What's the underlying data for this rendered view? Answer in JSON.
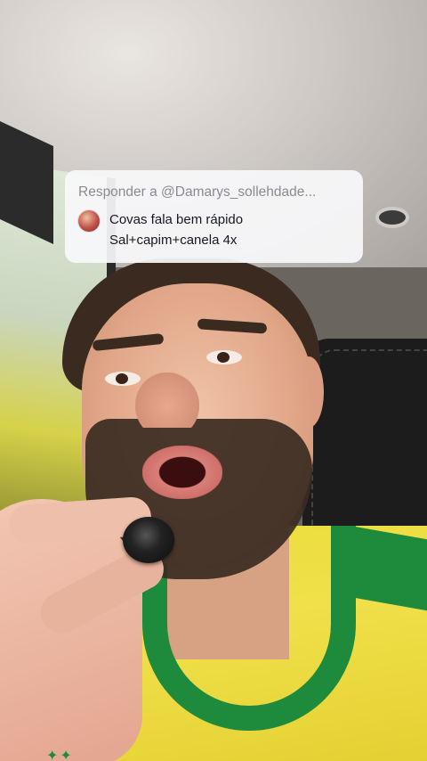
{
  "reply_card": {
    "header": "Responder a @Damarys_sollehdade...",
    "comment_line1": "Covas fala bem rápido",
    "comment_line2": "Sal+capim+canela 4x"
  },
  "colors": {
    "card_background": "#f8f8fa",
    "header_text": "#8a8a90",
    "comment_text": "#161823",
    "shirt_yellow": "#f1e04a",
    "shirt_green": "#1d8a3c"
  }
}
